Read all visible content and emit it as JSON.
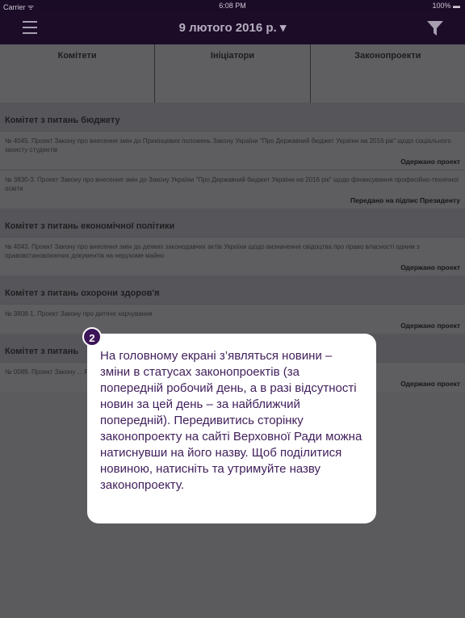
{
  "status_bar": {
    "carrier": "Carrier ᯤ",
    "time": "6:08 PM",
    "battery": "100% ▬"
  },
  "navbar": {
    "title": "9 лютого 2016 р. ▾",
    "menu_icon": "hamburger-icon",
    "filter_icon": "filter-icon"
  },
  "tabs": [
    "Комітети",
    "Ініціатори",
    "Законопроекти"
  ],
  "sections": [
    {
      "title": "Комітет з питань бюджету",
      "items": [
        {
          "desc": "№ 4045. Проект Закону про внесення змін до Прикінцевих положень Закону України \"Про Державний бюджет України на 2016 рік\" щодо соціального захисту студентів",
          "status": "Одержано проект"
        },
        {
          "desc": "№ 3830-3. Проект Закону про внесення змін до Закону України \"Про Державний бюджет України на 2016 рік\" щодо фінансування професійно-технічної освіти",
          "status": "Передано на підпис Президенту"
        }
      ]
    },
    {
      "title": "Комітет з питань економічної політики",
      "items": [
        {
          "desc": "№ 4043. Проект Закону про внесення змін до деяких законодавчих актів України щодо визначення свідоцтва про право власності одним з правовстановлюючих документів на нерухоме майно",
          "status": "Одержано проект"
        }
      ]
    },
    {
      "title": "Комітет з питань охорони здоров'я",
      "items": [
        {
          "desc": "№ 3808-1. Проект Закону про дитяче харчування",
          "status": "Одержано проект"
        }
      ]
    },
    {
      "title": "Комітет з питань",
      "items": [
        {
          "desc": "№ 0089. Проект Закону ... Республіки Кіпр про повітряне сполучення",
          "status": "Одержано проект"
        }
      ]
    }
  ],
  "tooltip": {
    "number": "2",
    "text": "На головному екрані з’являться новини – зміни в статусах законопроектів (за попередній робочий день, а в разі відсутності новин за цей день – за найближчий попередній). Передивитись сторінку законопроекту на сайті Верховної Ради можна натиснувши на його назву. Щоб поділитися новиною, натисніть та утримуйте назву законопроекту."
  },
  "colors": {
    "navbar": "#1c0c28",
    "accent": "#3c1658",
    "overlay": "#5b5a5d"
  }
}
